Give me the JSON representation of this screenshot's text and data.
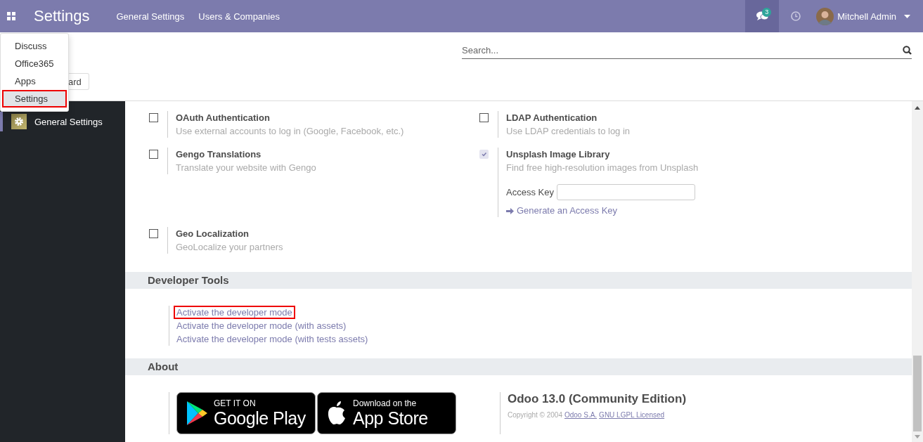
{
  "navbar": {
    "app_title": "Settings",
    "menus": [
      "General Settings",
      "Users & Companies"
    ],
    "messages_badge": "3",
    "user": "Mitchell Admin"
  },
  "app_menu": {
    "items": [
      {
        "label": "Discuss",
        "highlighted": false
      },
      {
        "label": "Office365",
        "highlighted": false
      },
      {
        "label": "Apps",
        "highlighted": false
      },
      {
        "label": "Settings",
        "highlighted": true
      }
    ]
  },
  "control_panel": {
    "search": {
      "placeholder": "Search..."
    },
    "button": "ard"
  },
  "sidebar": {
    "items": [
      {
        "label": "General Settings",
        "selected": true
      }
    ]
  },
  "settings": [
    {
      "title": "OAuth Authentication",
      "description": "Use external accounts to log in (Google, Facebook, etc.)",
      "checked": false,
      "disabled": false
    },
    {
      "title": "LDAP Authentication",
      "description": "Use LDAP credentials to log in",
      "checked": false,
      "disabled": false
    },
    {
      "title": "Gengo Translations",
      "description": "Translate your website with Gengo",
      "checked": false,
      "disabled": false
    },
    {
      "title": "Unsplash Image Library",
      "description": "Find free high-resolution images from Unsplash",
      "checked": true,
      "disabled": true,
      "field_label": "Access Key",
      "link": "Generate an Access Key"
    },
    {
      "title": "Geo Localization",
      "description": "GeoLocalize your partners",
      "checked": false,
      "disabled": false
    }
  ],
  "developer_tools": {
    "title": "Developer Tools",
    "links": [
      {
        "label": "Activate the developer mode",
        "highlighted": true
      },
      {
        "label": "Activate the developer mode (with assets)",
        "highlighted": false
      },
      {
        "label": "Activate the developer mode (with tests assets)",
        "highlighted": false
      }
    ]
  },
  "about": {
    "title": "About",
    "badges": [
      {
        "kind": "google",
        "line1": "GET IT ON",
        "line2": "Google Play"
      },
      {
        "kind": "apple",
        "line1": "Download on the",
        "line2": "App Store"
      }
    ],
    "version": "Odoo 13.0 (Community Edition)",
    "copyright": "Copyright © 2004",
    "links": [
      "Odoo S.A.",
      "GNU LGPL Licensed"
    ]
  }
}
